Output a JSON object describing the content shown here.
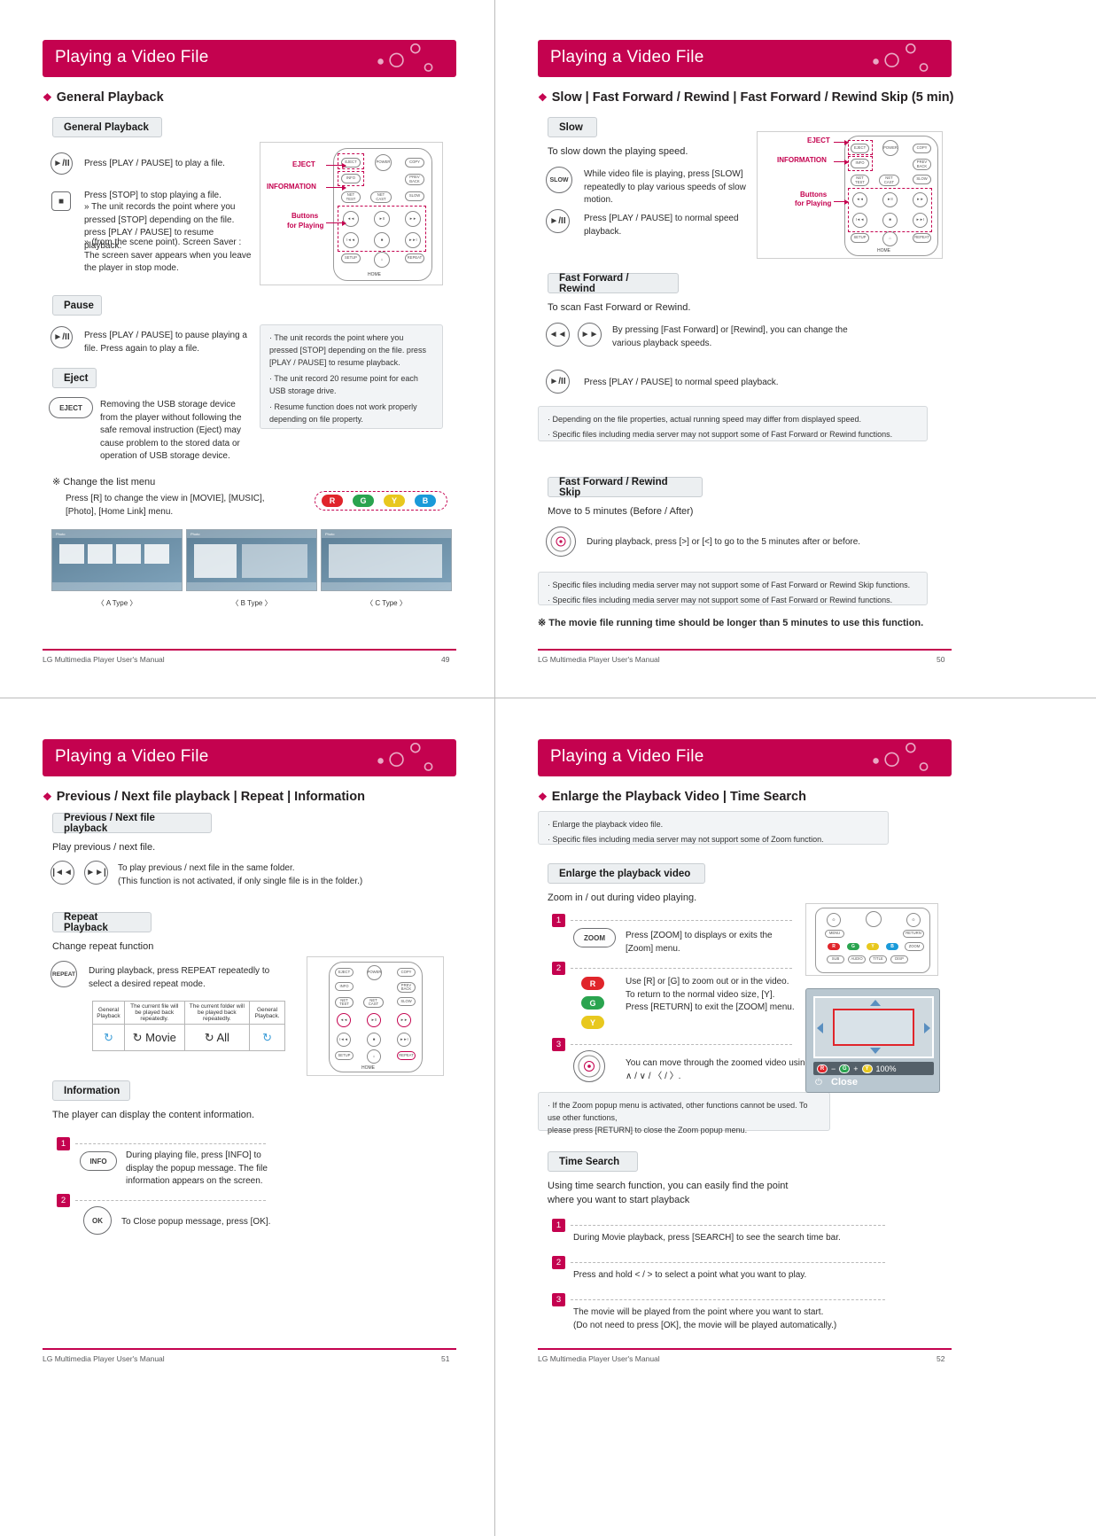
{
  "doc": {
    "footer_text": "LG Multimedia Player User's Manual"
  },
  "pages": [
    {
      "page_number": "49",
      "header": "Playing a Video File",
      "section_title": "General Playback",
      "blocks": {
        "general_playback_label": "General Playback",
        "pause_label": "Pause",
        "eject_label": "Eject",
        "play_text": "Press [PLAY / PAUSE] to play a file.",
        "stop_text_1": "Press [STOP] to stop playing a file.",
        "stop_text_2": "» The unit records the point where you pressed [STOP] depending on the file. press [PLAY / PAUSE]  to resume playback.",
        "stop_text_3": "» (from the scene point). Screen Saver : The screen saver  appears when you leave the player in stop mode.",
        "pause_text": "Press [PLAY / PAUSE] to pause playing a file. Press again to play a file.",
        "eject_text": "Removing the USB storage device from the player without following the safe removal instruction (Eject) may cause problem to the stored data or operation of USB storage device.",
        "note_lines": [
          "· The unit records the point where you pressed [STOP] depending on the file. press [PLAY / PAUSE]  to resume playback.",
          "· The unit record 20 resume point for each USB storage drive.",
          "· Resume function does not work properly depending on file property."
        ],
        "change_list_title": "※ Change the list menu",
        "change_list_text": "Press [R] to change the view in [MOVIE], [MUSIC], [Photo], [Home Link] menu.",
        "color_buttons": [
          "R",
          "G",
          "Y",
          "B"
        ],
        "tv_labels": [
          "〈 A Type 〉",
          "〈 B Type 〉",
          "〈 C Type 〉"
        ],
        "remote_callouts": [
          "EJECT",
          "INFORMATION",
          "Buttons",
          "for Playing"
        ],
        "icons": {
          "play_pause": "►/II",
          "stop": "■",
          "eject": "EJECT"
        }
      }
    },
    {
      "page_number": "50",
      "header": "Playing a Video File",
      "section_title": "Slow | Fast Forward / Rewind | Fast Forward / Rewind Skip (5 min)",
      "blocks": {
        "slow_label": "Slow",
        "slow_desc": "To slow down the playing speed.",
        "slow_text_1": "While video file is playing, press [SLOW] repeatedly to play various speeds of slow motion.",
        "slow_text_2": "Press [PLAY / PAUSE] to normal speed playback.",
        "ffrw_label": "Fast Forward / Rewind",
        "ffrw_desc": "To scan Fast Forward or Rewind.",
        "ffrw_text_1": "By pressing [Fast Forward] or [Rewind], you can change the various playback speeds.",
        "ffrw_text_2": "Press [PLAY / PAUSE] to normal speed playback.",
        "ffrw_note": [
          "· Depending on the file properties, actual running speed may differ from displayed speed.",
          "· Specific files including media server may not support some of Fast Forward or Rewind functions."
        ],
        "skip_label": "Fast Forward / Rewind Skip",
        "skip_desc": "Move to 5 minutes (Before / After)",
        "skip_text": "During playback, press [>] or [<]  to go to the 5 minutes after or before.",
        "skip_note": [
          "· Specific files including media server may not support some of Fast Forward or Rewind Skip functions.",
          "· Specific files including media server may not support some of Fast Forward or Rewind functions."
        ],
        "footnote": "※ The movie file running time should be longer than 5 minutes to use this function.",
        "remote_callouts": [
          "EJECT",
          "INFORMATION",
          "Buttons",
          "for Playing"
        ],
        "icons": {
          "slow": "SLOW",
          "play_pause": "►/II",
          "rewind": "◄◄",
          "forward": "►►"
        }
      }
    },
    {
      "page_number": "51",
      "header": "Playing a Video File",
      "section_title": "Previous / Next file playback | Repeat | Information",
      "blocks": {
        "prev_next_label": "Previous / Next file playback",
        "prev_next_desc": "Play previous / next file.",
        "prev_next_text": "To play previous / next file in the same folder.\n(This function is not activated, if only single file is in the folder.)",
        "repeat_label": "Repeat Playback",
        "repeat_desc": "Change repeat function",
        "repeat_text": "During playback, press REPEAT repeatedly to select a desired repeat mode.",
        "repeat_table": [
          "General Playback",
          "The current file will be played back repeatedly.",
          "The current folder will be played back repeatedly.",
          "General Playback."
        ],
        "repeat_table_icons": [
          "↻",
          "↻ Movie",
          "↻ All",
          "↻"
        ],
        "information_label": "Information",
        "information_desc": "The player can display the content information.",
        "steps": [
          {
            "num": "1",
            "text": "During playing file, press [INFO] to display the popup message. The file information appears on the screen.",
            "icon": "INFO"
          },
          {
            "num": "2",
            "text": "To Close popup message, press [OK].",
            "icon": "OK"
          }
        ],
        "icons": {
          "prev": "|◄◄",
          "next": "►►|",
          "repeat": "REPEAT"
        }
      }
    },
    {
      "page_number": "52",
      "header": "Playing a Video File",
      "section_title": "Enlarge the Playback Video | Time Search",
      "blocks": {
        "top_note": [
          "· Enlarge the playback video file.",
          "· Specific files including media server may not support some of Zoom function."
        ],
        "enlarge_label": "Enlarge the playback video",
        "enlarge_desc": "Zoom in / out during video playing.",
        "steps": [
          {
            "num": "1",
            "text": "Press [ZOOM]  to displays or exits the [Zoom] menu.",
            "icon": "ZOOM"
          },
          {
            "num": "2",
            "text": "Use [R] or [G] to zoom out or in the video.\nTo return to the normal video size, [Y].\nPress [RETURN] to exit the [ZOOM] menu.",
            "icon": ""
          },
          {
            "num": "3",
            "text": "You can move through the zoomed video using ∧ / ∨ / 〈 / 〉.",
            "icon": ""
          }
        ],
        "color_buttons": [
          "R",
          "G",
          "Y"
        ],
        "zoom_note": "· If the Zoom popup menu is activated, other functions cannot be used. To use other functions,\n  please press [RETURN] to close the Zoom popup menu.",
        "zoom_osd": {
          "r": "R",
          "minus": "−",
          "g": "G",
          "plus": "+",
          "y": "Y",
          "percent": "100%",
          "close": "Close"
        },
        "time_search_label": "Time Search",
        "time_search_desc": "Using time search function, you can easily find the point\nwhere you want to start playback",
        "time_steps": [
          {
            "num": "1",
            "text": "During Movie playback, press [SEARCH] to see the search time bar."
          },
          {
            "num": "2",
            "text": "Press and hold < / > to select a point what you want to play."
          },
          {
            "num": "3",
            "text": "The movie will be played from the point where you want to start.\n(Do not need to press [OK], the movie will be played automatically.)"
          }
        ]
      }
    }
  ],
  "colors": {
    "brand": "#c4024f",
    "panel": "#eceff1",
    "note": "#f2f4f6",
    "red_btn": "#e0252b",
    "green_btn": "#2aa44f",
    "yellow_btn": "#e8c81e",
    "blue_btn": "#1a9ad9"
  }
}
